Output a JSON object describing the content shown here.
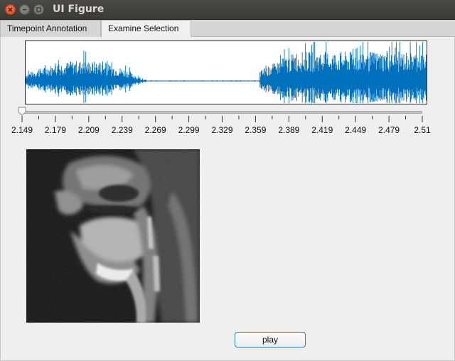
{
  "window": {
    "title": "UI Figure",
    "controls": [
      "close-icon",
      "minimize-icon",
      "maximize-icon"
    ]
  },
  "tabs": [
    {
      "label": "Timepoint Annotation",
      "selected": false
    },
    {
      "label": "Examine Selection",
      "selected": true
    }
  ],
  "slider": {
    "value": 2.149,
    "min": 2.149,
    "max": 2.51,
    "tick_labels": [
      "2.149",
      "2.179",
      "2.209",
      "2.239",
      "2.269",
      "2.299",
      "2.329",
      "2.359",
      "2.389",
      "2.419",
      "2.449",
      "2.479",
      "2.51"
    ]
  },
  "waveform": {
    "color": "#0072bd",
    "segments": [
      {
        "from": 2.149,
        "to": 2.26,
        "amplitude": "medium"
      },
      {
        "from": 2.26,
        "to": 2.36,
        "amplitude": "silent"
      },
      {
        "from": 2.36,
        "to": 2.51,
        "amplitude": "high"
      }
    ]
  },
  "image": {
    "kind": "grayscale MRI sagittal head slice"
  },
  "play_button": {
    "label": "play"
  },
  "colors": {
    "accent": "#2a7fc8",
    "close": "#dd4814",
    "background": "#efefef"
  }
}
